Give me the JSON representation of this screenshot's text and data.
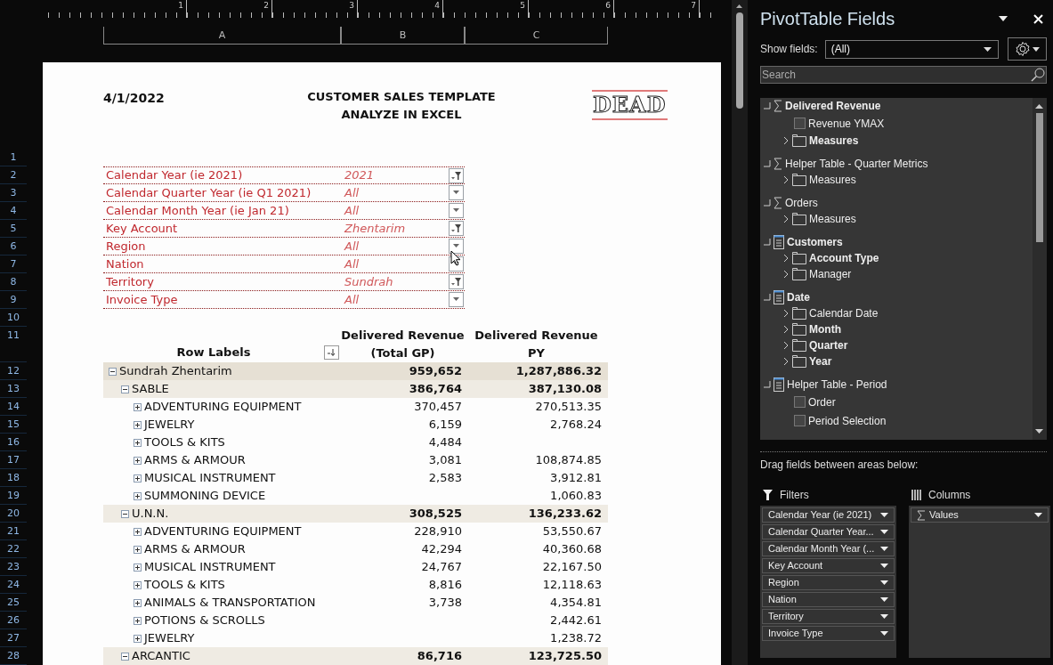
{
  "ruler": {
    "labels": [
      "1",
      "2",
      "3",
      "4",
      "5",
      "6",
      "7"
    ]
  },
  "columns": [
    "A",
    "B",
    "C"
  ],
  "row_numbers": [
    "1",
    "2",
    "3",
    "4",
    "5",
    "6",
    "7",
    "8",
    "9",
    "10",
    "11",
    "12",
    "13",
    "14",
    "15",
    "16",
    "17",
    "18",
    "19",
    "20",
    "21",
    "22",
    "23",
    "24",
    "25",
    "26",
    "27",
    "28"
  ],
  "header": {
    "date": "4/1/2022",
    "title_lines": [
      "CUSTOMER SALES TEMPLATE",
      "ANALYZE IN EXCEL"
    ],
    "logo": "DEAD"
  },
  "filters": [
    {
      "label": "Calendar Year (ie 2021)",
      "value": "2021",
      "filtered": true
    },
    {
      "label": "Calendar Quarter Year (ie Q1 2021)",
      "value": "All",
      "filtered": false
    },
    {
      "label": "Calendar Month Year (ie Jan 21)",
      "value": "All",
      "filtered": false
    },
    {
      "label": "Key Account",
      "value": "Zhentarim",
      "filtered": true
    },
    {
      "label": "Region",
      "value": "All",
      "filtered": false
    },
    {
      "label": "Nation",
      "value": "All",
      "filtered": false
    },
    {
      "label": "Territory",
      "value": "Sundrah",
      "filtered": true
    },
    {
      "label": "Invoice Type",
      "value": "All",
      "filtered": false
    }
  ],
  "pivot": {
    "row_labels": "Row Labels",
    "value_columns": [
      {
        "lines": [
          "Delivered Revenue",
          "(Total GP)"
        ]
      },
      {
        "lines": [
          "Delivered Revenue PY"
        ]
      }
    ],
    "rows": [
      {
        "label": "Sundrah Zhentarim",
        "gp": "959,652",
        "py": "1,287,886.32",
        "expanded": true,
        "children": [
          {
            "label": "SABLE",
            "gp": "386,764",
            "py": "387,130.08",
            "expanded": true,
            "children": [
              {
                "label": "ADVENTURING EQUIPMENT",
                "gp": "370,457",
                "py": "270,513.35",
                "expanded": false
              },
              {
                "label": "JEWELRY",
                "gp": "6,159",
                "py": "2,768.24",
                "expanded": false
              },
              {
                "label": "TOOLS & KITS",
                "gp": "4,484",
                "expanded": false
              },
              {
                "label": "ARMS & ARMOUR",
                "gp": "3,081",
                "py": "108,874.85",
                "expanded": false
              },
              {
                "label": "MUSICAL INSTRUMENT",
                "gp": "2,583",
                "py": "3,912.81",
                "expanded": false
              },
              {
                "label": "SUMMONING DEVICE",
                "py": "1,060.83",
                "expanded": false
              }
            ]
          },
          {
            "label": "U.N.N.",
            "gp": "308,525",
            "py": "136,233.62",
            "expanded": true,
            "children": [
              {
                "label": "ADVENTURING EQUIPMENT",
                "gp": "228,910",
                "py": "53,550.67",
                "expanded": false
              },
              {
                "label": "ARMS & ARMOUR",
                "gp": "42,294",
                "py": "40,360.68",
                "expanded": false
              },
              {
                "label": "MUSICAL INSTRUMENT",
                "gp": "24,767",
                "py": "22,167.50",
                "expanded": false
              },
              {
                "label": "TOOLS & KITS",
                "gp": "8,816",
                "py": "12,118.63",
                "expanded": false
              },
              {
                "label": "ANIMALS & TRANSPORTATION",
                "gp": "3,738",
                "py": "4,354.81",
                "expanded": false
              },
              {
                "label": "POTIONS & SCROLLS",
                "py": "2,442.61",
                "expanded": false
              },
              {
                "label": "JEWELRY",
                "py": "1,238.72",
                "expanded": false
              }
            ]
          },
          {
            "label": "ARCANTIC",
            "gp": "86,716",
            "py": "123,725.50",
            "expanded": true
          }
        ]
      }
    ]
  },
  "panel": {
    "title": "PivotTable Fields",
    "show_fields_label": "Show fields:",
    "show_fields_value": "(All)",
    "search_placeholder": "Search",
    "groups": [
      {
        "name": "Delivered Revenue",
        "kind": "measure",
        "bold": true,
        "items": [
          {
            "name": "Revenue YMAX",
            "kind": "field",
            "bold": false,
            "checked": false
          },
          {
            "name": "Measures",
            "kind": "folder",
            "bold": true
          }
        ]
      },
      {
        "name": "Helper Table - Quarter Metrics",
        "kind": "measure",
        "bold": false,
        "items": [
          {
            "name": "Measures",
            "kind": "folder",
            "bold": false
          }
        ]
      },
      {
        "name": "Orders",
        "kind": "measure",
        "bold": false,
        "items": [
          {
            "name": "Measures",
            "kind": "folder",
            "bold": false
          }
        ]
      },
      {
        "name": "Customers",
        "kind": "table",
        "bold": true,
        "items": [
          {
            "name": "Account Type",
            "kind": "folder",
            "bold": true
          },
          {
            "name": "Manager",
            "kind": "folder",
            "bold": false
          }
        ]
      },
      {
        "name": "Date",
        "kind": "table",
        "bold": true,
        "items": [
          {
            "name": "Calendar Date",
            "kind": "folder",
            "bold": false
          },
          {
            "name": "Month",
            "kind": "folder",
            "bold": true
          },
          {
            "name": "Quarter",
            "kind": "folder",
            "bold": true
          },
          {
            "name": "Year",
            "kind": "folder",
            "bold": true
          }
        ]
      },
      {
        "name": "Helper Table - Period",
        "kind": "table",
        "bold": false,
        "items": [
          {
            "name": "Order",
            "kind": "field",
            "bold": false,
            "checked": false
          },
          {
            "name": "Period Selection",
            "kind": "field",
            "bold": false,
            "checked": false
          }
        ]
      }
    ],
    "drag_hint": "Drag fields between areas below:",
    "filters_area": {
      "title": "Filters",
      "items": [
        "Calendar Year (ie 2021)",
        "Calendar Quarter Year...",
        "Calendar Month Year (...",
        "Key Account",
        "Region",
        "Nation",
        "Territory",
        "Invoice Type"
      ]
    },
    "columns_area": {
      "title": "Columns",
      "items": [
        {
          "label": "Values",
          "kind": "values"
        }
      ]
    }
  }
}
